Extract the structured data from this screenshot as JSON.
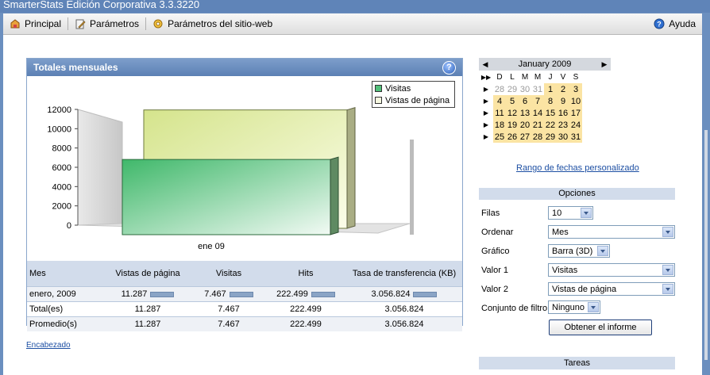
{
  "window": {
    "title": "SmarterStats Edición Corporativa 3.3.3220"
  },
  "toolbar": {
    "items": [
      {
        "label": "Principal",
        "icon": "home-icon"
      },
      {
        "label": "Parámetros",
        "icon": "settings-pencil-icon"
      },
      {
        "label": "Parámetros del sitio-web",
        "icon": "site-gear-icon"
      }
    ],
    "help_label": "Ayuda"
  },
  "panel": {
    "title": "Totales mensuales",
    "help_glyph": "?"
  },
  "chart_data": {
    "type": "bar",
    "style": "3d",
    "categories": [
      "ene 09"
    ],
    "series": [
      {
        "name": "Visitas",
        "values": [
          7467
        ],
        "color": "#52c07a"
      },
      {
        "name": "Vistas de página",
        "values": [
          11287
        ],
        "color": "#e3ecb3"
      }
    ],
    "y_ticks": [
      0,
      2000,
      4000,
      6000,
      8000,
      10000,
      12000
    ],
    "ylim": [
      0,
      12000
    ],
    "legend_position": "top-right",
    "grid": false
  },
  "stats_table": {
    "headers": [
      "Mes",
      "Vistas de página",
      "Visitas",
      "Hits",
      "Tasa de transferencia (KB)"
    ],
    "rows": [
      {
        "mes": "enero, 2009",
        "vistas": "11.287",
        "visitas": "7.467",
        "hits": "222.499",
        "tasa": "3.056.824"
      },
      {
        "mes": "Total(es)",
        "vistas": "11.287",
        "visitas": "7.467",
        "hits": "222.499",
        "tasa": "3.056.824"
      },
      {
        "mes": "Promedio(s)",
        "vistas": "11.287",
        "visitas": "7.467",
        "hits": "222.499",
        "tasa": "3.056.824"
      }
    ]
  },
  "links": {
    "encabezado": "Encabezado",
    "rango": "Rango de fechas personalizado"
  },
  "calendar": {
    "month_label": "January 2009",
    "prev_glyph": "◀",
    "next_glyph": "▶",
    "week_glyph": "▶",
    "all_glyph": "▶▶",
    "dow": [
      "D",
      "L",
      "M",
      "M",
      "J",
      "V",
      "S"
    ],
    "weeks": [
      [
        {
          "d": "28",
          "o": true
        },
        {
          "d": "29",
          "o": true
        },
        {
          "d": "30",
          "o": true
        },
        {
          "d": "31",
          "o": true
        },
        {
          "d": "1"
        },
        {
          "d": "2"
        },
        {
          "d": "3"
        }
      ],
      [
        {
          "d": "4"
        },
        {
          "d": "5"
        },
        {
          "d": "6"
        },
        {
          "d": "7"
        },
        {
          "d": "8"
        },
        {
          "d": "9"
        },
        {
          "d": "10"
        }
      ],
      [
        {
          "d": "11"
        },
        {
          "d": "12"
        },
        {
          "d": "13"
        },
        {
          "d": "14"
        },
        {
          "d": "15"
        },
        {
          "d": "16"
        },
        {
          "d": "17"
        }
      ],
      [
        {
          "d": "18"
        },
        {
          "d": "19"
        },
        {
          "d": "20"
        },
        {
          "d": "21"
        },
        {
          "d": "22"
        },
        {
          "d": "23"
        },
        {
          "d": "24"
        }
      ],
      [
        {
          "d": "25"
        },
        {
          "d": "26"
        },
        {
          "d": "27"
        },
        {
          "d": "28"
        },
        {
          "d": "29"
        },
        {
          "d": "30"
        },
        {
          "d": "31"
        }
      ]
    ],
    "highlight_color": "#fbe4a3"
  },
  "options": {
    "title": "Opciones",
    "filas": {
      "label": "Filas",
      "value": "10"
    },
    "ordenar": {
      "label": "Ordenar",
      "value": "Mes"
    },
    "grafico": {
      "label": "Gráfico",
      "value": "Barra (3D)"
    },
    "valor1": {
      "label": "Valor 1",
      "value": "Visitas"
    },
    "valor2": {
      "label": "Valor 2",
      "value": "Vistas de página"
    },
    "filtro": {
      "label": "Conjunto de filtro",
      "value": "Ninguno"
    },
    "submit_label": "Obtener el informe"
  },
  "tasks": {
    "title": "Tareas"
  }
}
